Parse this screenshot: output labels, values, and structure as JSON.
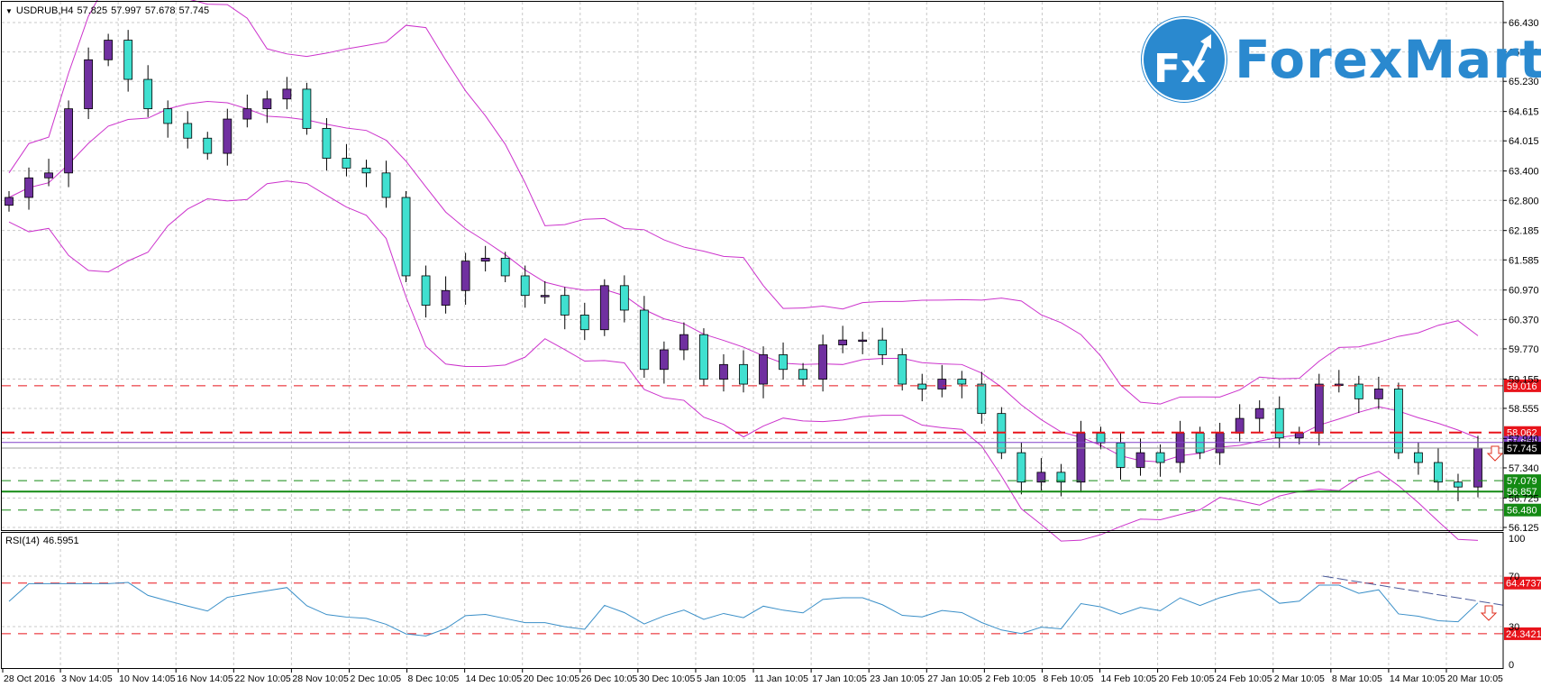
{
  "header": {
    "symbol": "USDRUB,H4",
    "open": "57.825",
    "high": "57.997",
    "low": "57.678",
    "close": "57.745"
  },
  "rsi_header": {
    "label": "RSI(14)",
    "value": "46.5951"
  },
  "logo": {
    "text": "ForexMart",
    "mark": "Fx",
    "color": "#2a89cf"
  },
  "colors": {
    "bull": "#7030a0",
    "bear": "#40e0d0",
    "bands": "#cc33cc",
    "rsi": "#3a8fc8",
    "grid": "#c8c8c8"
  },
  "chart_data": {
    "type": "candlestick",
    "symbol": "USDRUB",
    "timeframe": "H4",
    "price_ticks": [
      "66.430",
      "65.830",
      "65.230",
      "64.615",
      "64.015",
      "63.400",
      "62.800",
      "62.185",
      "61.585",
      "60.970",
      "60.370",
      "59.770",
      "59.155",
      "58.555",
      "57.940",
      "57.340",
      "56.725",
      "56.125"
    ],
    "ylim": [
      56.125,
      66.43
    ],
    "time_ticks": [
      "28 Oct 2016",
      "3 Nov 14:05",
      "10 Nov 14:05",
      "16 Nov 14:05",
      "22 Nov 10:05",
      "28 Nov 10:05",
      "2 Dec 10:05",
      "8 Dec 10:05",
      "14 Dec 10:05",
      "20 Dec 10:05",
      "26 Dec 10:05",
      "30 Dec 10:05",
      "5 Jan 10:05",
      "11 Jan 10:05",
      "17 Jan 10:05",
      "23 Jan 10:05",
      "27 Jan 10:05",
      "2 Feb 10:05",
      "8 Feb 10:05",
      "14 Feb 10:05",
      "20 Feb 10:05",
      "24 Feb 10:05",
      "2 Mar 10:05",
      "8 Mar 10:05",
      "14 Mar 10:05",
      "20 Mar 10:05"
    ],
    "first_open": 62.7,
    "closes": [
      62.86,
      63.26,
      63.36,
      64.67,
      65.67,
      66.07,
      65.27,
      64.67,
      64.37,
      64.07,
      63.76,
      64.46,
      64.67,
      64.87,
      65.07,
      64.27,
      63.66,
      63.46,
      63.36,
      62.86,
      61.26,
      60.66,
      60.96,
      61.56,
      61.62,
      61.26,
      60.86,
      60.86,
      60.46,
      60.16,
      61.06,
      60.56,
      59.35,
      59.75,
      60.06,
      59.15,
      59.45,
      59.05,
      59.65,
      59.35,
      59.15,
      59.85,
      59.95,
      59.95,
      59.65,
      59.05,
      58.95,
      59.15,
      59.05,
      58.45,
      57.65,
      57.05,
      57.25,
      57.05,
      58.05,
      57.85,
      57.35,
      57.65,
      57.45,
      58.05,
      57.65,
      58.05,
      58.35,
      58.55,
      57.95,
      58.05,
      59.05,
      59.05,
      58.75,
      58.95,
      57.65,
      57.45,
      57.05,
      56.95,
      57.745
    ],
    "indicators": [
      "Bollinger Bands",
      "RSI(14)"
    ],
    "levels": [
      {
        "price": "59.016",
        "color": "#e8141b",
        "style": "dashed"
      },
      {
        "price": "58.062",
        "color": "#e8141b",
        "style": "dashed-thick"
      },
      {
        "price": "57.860",
        "color": "#8040c8",
        "style": "solid"
      },
      {
        "price": "57.745",
        "color": "#000000",
        "style": "solid"
      },
      {
        "price": "57.079",
        "color": "#138a13",
        "style": "dashed"
      },
      {
        "price": "56.857",
        "color": "#138a13",
        "style": "solid-thick"
      },
      {
        "price": "56.480",
        "color": "#138a13",
        "style": "dashed"
      }
    ],
    "rsi_ticks": [
      "100",
      "70",
      "30",
      "0"
    ],
    "rsi_levels": [
      {
        "value": "64.4737",
        "color": "#e8141b"
      },
      {
        "value": "24.3421",
        "color": "#e8141b"
      }
    ],
    "rsi_trendline": {
      "from_time": "8 Mar 10:05",
      "from_value": 70,
      "to_value": 47,
      "color": "#4a5a9a"
    },
    "signals": [
      "down-arrow"
    ]
  }
}
